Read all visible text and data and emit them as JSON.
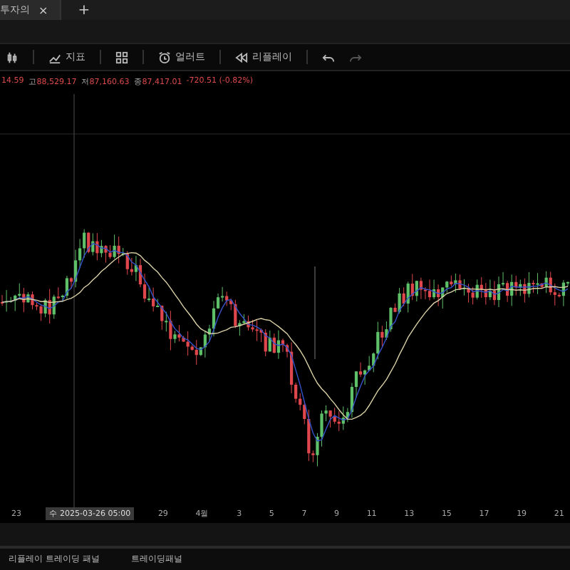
{
  "tabs": [
    {
      "label": "투자의",
      "selected": true
    }
  ],
  "tab_close": "×",
  "new_tab": "+",
  "toolbar": [
    {
      "kind": "icon"
    },
    {
      "kind": "text",
      "label": "지표"
    },
    {
      "kind": "icon"
    },
    {
      "kind": "text",
      "label": "얼러트"
    },
    {
      "kind": "text",
      "label": "리플레이"
    },
    {
      "kind": "icon"
    },
    {
      "kind": "icon"
    }
  ],
  "ohlc": [
    {
      "value": "14.59"
    },
    {
      "label": "고",
      "value": "88,529.17"
    },
    {
      "label": "저",
      "value": "87,160.63"
    },
    {
      "label": "종",
      "value": "87,417.01"
    },
    {
      "value": "-720.51 (-0.82%)"
    }
  ],
  "time_axis": [
    {
      "label": "23",
      "selected": false
    },
    {
      "label": "수 2025-03-26  05:00",
      "selected": true
    },
    {
      "label": "29",
      "selected": false
    },
    {
      "label": "4월",
      "selected": false
    },
    {
      "label": "3",
      "selected": false
    },
    {
      "label": "5",
      "selected": false
    },
    {
      "label": "7",
      "selected": false
    },
    {
      "label": "9",
      "selected": false
    },
    {
      "label": "11",
      "selected": false
    },
    {
      "label": "13",
      "selected": false
    },
    {
      "label": "15",
      "selected": false
    },
    {
      "label": "17",
      "selected": false
    },
    {
      "label": "19",
      "selected": false
    },
    {
      "label": "21",
      "selected": false
    }
  ],
  "bottom_tabs": [
    {
      "label": "리플레이 트레이딩 패널",
      "selected": false
    },
    {
      "label": "트레이딩패널",
      "selected": false
    }
  ]
}
